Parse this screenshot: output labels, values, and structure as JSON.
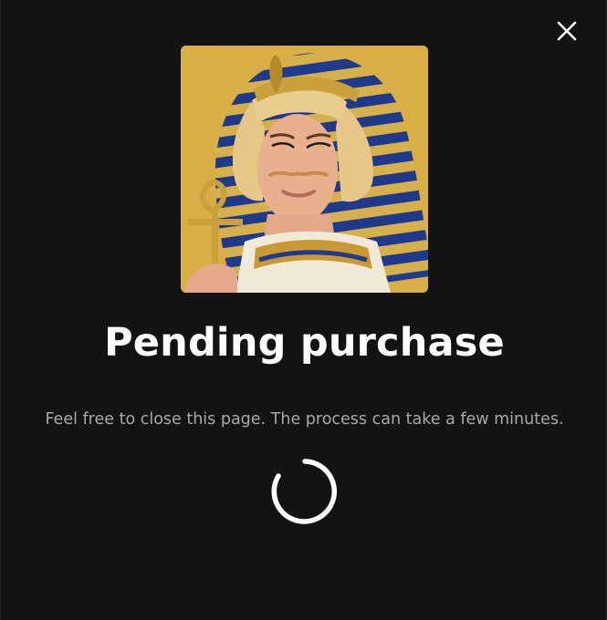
{
  "dialog": {
    "title": "Pending purchase",
    "message": "Feel free to close this page. The process can take a few minutes."
  },
  "icons": {
    "close": "close-icon",
    "loading": "loading-spinner-icon"
  },
  "colors": {
    "background": "#131313",
    "title": "#ffffff",
    "message": "#a9a9a9",
    "image_background": "#d8ae45"
  }
}
